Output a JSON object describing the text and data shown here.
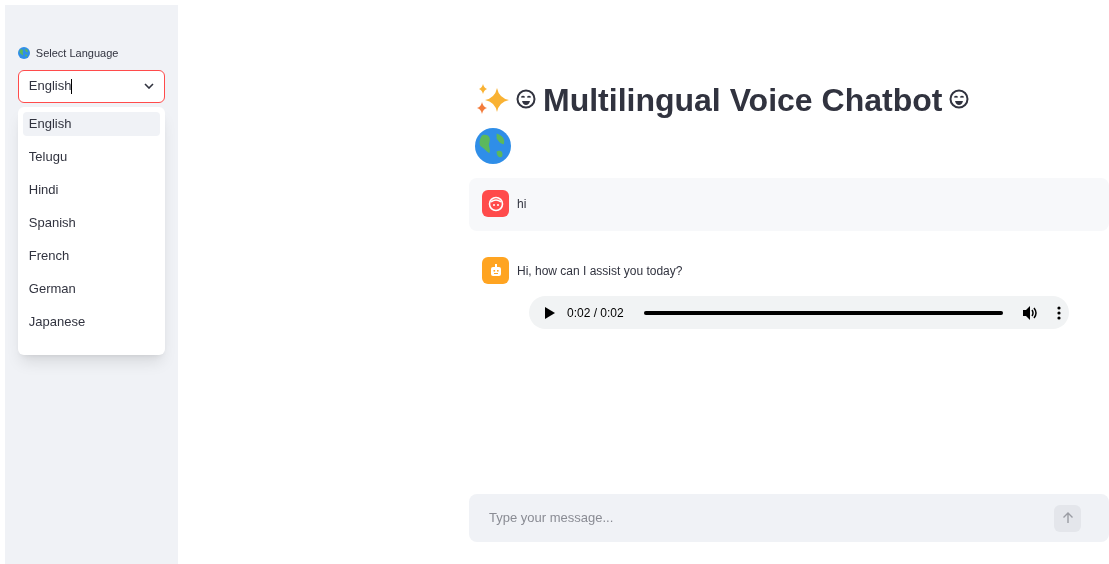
{
  "sidebar": {
    "label": "Select Language",
    "select": {
      "value": "English",
      "focused": true
    },
    "options": [
      {
        "label": "English",
        "selected": true
      },
      {
        "label": "Telugu",
        "selected": false
      },
      {
        "label": "Hindi",
        "selected": false
      },
      {
        "label": "Spanish",
        "selected": false
      },
      {
        "label": "French",
        "selected": false
      },
      {
        "label": "German",
        "selected": false
      },
      {
        "label": "Japanese",
        "selected": false
      }
    ]
  },
  "title": "Multilingual Voice Chatbot",
  "messages": [
    {
      "kind": "user",
      "text": "hi"
    },
    {
      "kind": "assistant",
      "text": "Hi, how can I assist you today?",
      "audio": {
        "time": "0:02 / 0:02",
        "level": 1
      }
    }
  ],
  "chat_input": {
    "placeholder": "Type your message..."
  }
}
